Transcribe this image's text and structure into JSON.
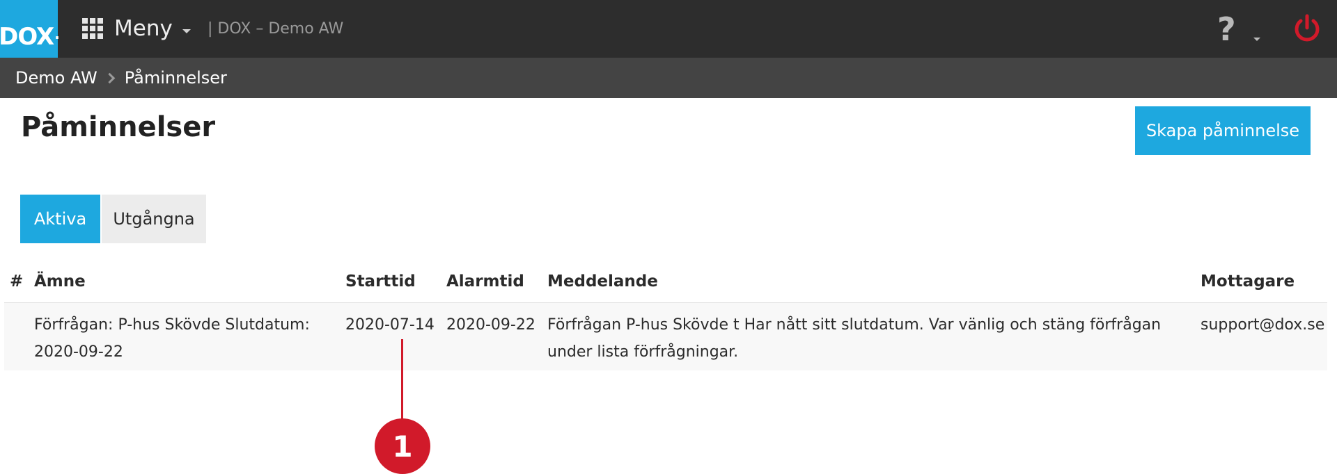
{
  "header": {
    "logo_text": "DOX",
    "logo_dot": ".",
    "menu_label": "Meny",
    "app_title": "| DOX – Demo AW",
    "help_symbol": "?",
    "help_icon": "question-icon",
    "power_icon": "power-icon",
    "colors": {
      "bar": "#2d2d2d",
      "accent": "#1ea8df",
      "power": "#d11a2a"
    }
  },
  "breadcrumb": {
    "items": [
      {
        "label": "Demo AW"
      },
      {
        "label": "Påminnelser"
      }
    ]
  },
  "page": {
    "title": "Påminnelser",
    "create_button": "Skapa påminnelse"
  },
  "tabs": [
    {
      "label": "Aktiva",
      "active": true
    },
    {
      "label": "Utgångna",
      "active": false
    }
  ],
  "table": {
    "headers": {
      "hash": "#",
      "subject": "Ämne",
      "start": "Starttid",
      "alarm": "Alarmtid",
      "message": "Meddelande",
      "recipient": "Mottagare"
    },
    "rows": [
      {
        "subject_line1": "Förfrågan: P-hus Skövde Slutdatum:",
        "subject_line2": "2020-09-22",
        "start": "2020-07-14",
        "alarm": "2020-09-22",
        "message_line1": "Förfrågan P-hus Skövde t Har nått sitt slutdatum. Var vänlig och stäng förfrågan",
        "message_line2": "under lista förfrågningar.",
        "recipient": "support@dox.se"
      }
    ]
  },
  "callout": {
    "number": "1",
    "color": "#d11a2a"
  }
}
